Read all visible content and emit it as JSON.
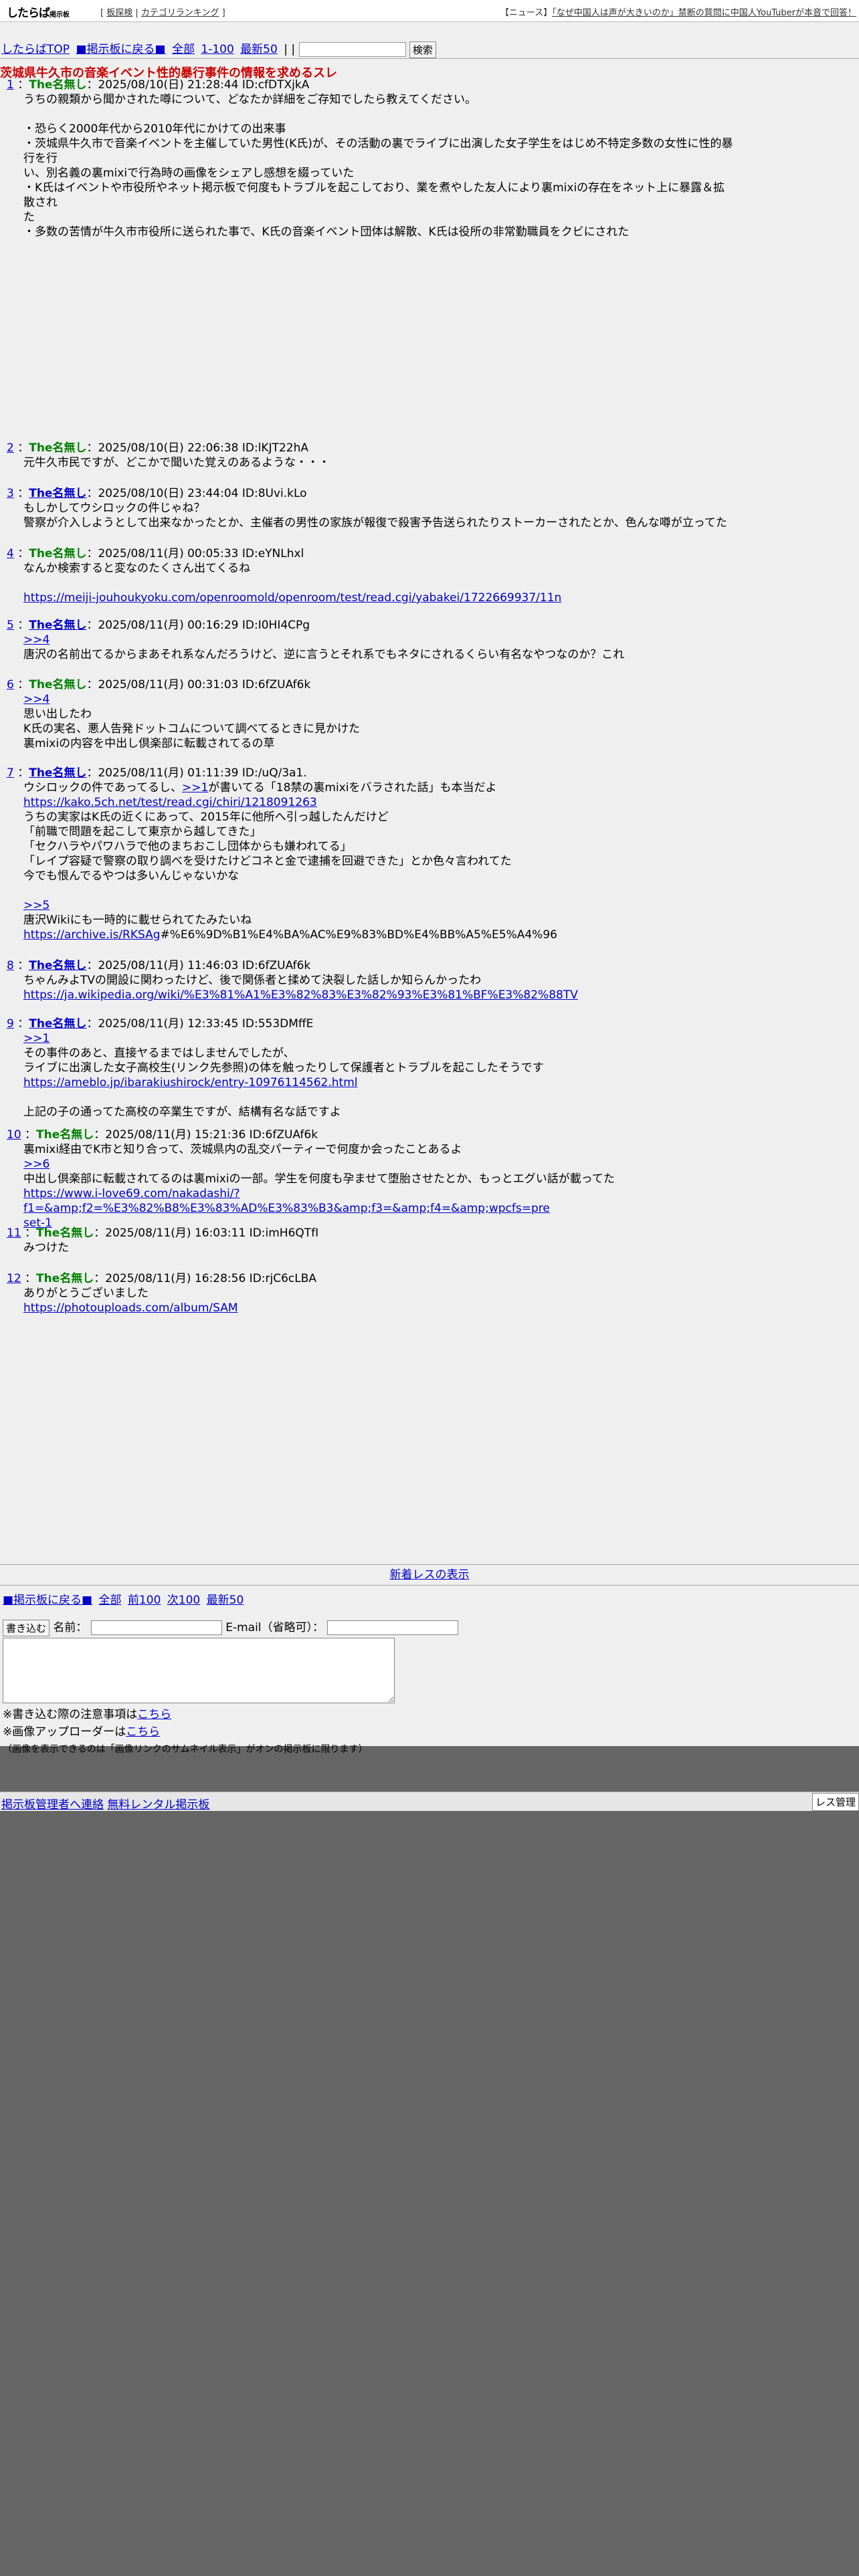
{
  "header": {
    "logo_main": "したらば",
    "logo_sub": "掲示板",
    "bracket_open": "[",
    "bracket_close": "]",
    "sep": "|",
    "link_portal": "板探検",
    "link_ranking": "カテゴリランキング",
    "news_label": "【ニュース】",
    "news_text": "「なぜ中国人は声が大きいのか」禁断の質問に中国人YouTuberが本音で回答！"
  },
  "nav": {
    "top": "したらばTOP",
    "back": "■掲示板に戻る■",
    "all": "全部",
    "range": "1-100",
    "latest": "最新50",
    "pipes": "| |",
    "search_button": "検索"
  },
  "thread": {
    "title": "茨城県牛久市の音楽イベント性的暴行事件の情報を求めるスレ"
  },
  "posts": [
    {
      "num": "1",
      "name": "The名無し",
      "date": "：2025/08/10(日) 21:28:44 ID:cfDTXjkA",
      "lines": [
        "うちの親類から聞かされた噂について、どなたか詳細をご存知でしたら教えてください。",
        "",
        "・恐らく2000年代から2010年代にかけての出来事",
        "・茨城県牛久市で音楽イベントを主催していた男性(K氏)が、その活動の裏でライブに出演した女子学生をはじめ不特定多数の女性に性的暴行を行",
        "い、別名義の裏mixiで行為時の画像をシェアし感想を綴っていた",
        "・K氏はイベントや市役所やネット掲示板で何度もトラブルを起こしており、業を煮やした友人により裏mixiの存在をネット上に暴露＆拡散され",
        "た",
        "・多数の苦情が牛久市市役所に送られた事で、K氏の音楽イベント団体は解散、K氏は役所の非常勤職員をクビにされた"
      ]
    },
    {
      "num": "2",
      "name": "The名無し",
      "date": "：2025/08/10(日) 22:06:38 ID:lKJT22hA",
      "lines": [
        "元牛久市民ですが、どこかで聞いた覚えのあるような・・・"
      ]
    },
    {
      "num": "3",
      "name": "The名無し",
      "date": "：2025/08/10(日) 23:44:04 ID:8Uvi.kLo",
      "lines": [
        "もしかしてウシロックの件じゃね？",
        "警察が介入しようとして出来なかったとか、主催者の男性の家族が報復で殺害予告送られたりストーカーされたとか、色んな噂が立ってた"
      ]
    },
    {
      "num": "4",
      "name": "The名無し",
      "date": "：2025/08/11(月) 00:05:33 ID:eYNLhxl",
      "lines": [
        "なんか検索すると変なのたくさん出てくるね",
        ""
      ],
      "link": "https://meiji-jouhoukyoku.com/openroomold/openroom/test/read.cgi/yabakei/1722669937/11n"
    },
    {
      "num": "5",
      "name": "The名無し",
      "date": "：2025/08/11(月) 00:16:29 ID:I0HI4CPg",
      "anchor": ">>4",
      "lines": [
        "唐沢の名前出てるからまあそれ系なんだろうけど、逆に言うとそれ系でもネタにされるくらい有名なやつなのか？これ"
      ]
    },
    {
      "num": "6",
      "name": "The名無し",
      "date": "：2025/08/11(月) 00:31:03 ID:6fZUAf6k",
      "anchor": ">>4",
      "lines": [
        "思い出したわ",
        "K氏の実名、悪人告発ドットコムについて調べてるときに見かけた",
        "裏mixiの内容を中出し倶楽部に転載されてるの草"
      ]
    },
    {
      "num": "7",
      "name": "The名無し",
      "date": "：2025/08/11(月) 01:11:39 ID:/uQ/3a1.",
      "line1_pre": "ウシロックの件であってるし、",
      "line1_anchor": ">>1",
      "line1_post": "が書いてる「18禁の裏mixiをバラされた話」も本当だよ",
      "link1": "https://kako.5ch.net/test/read.cgi/chiri/1218091263",
      "lines": [
        "うちの実家はK氏の近くにあって、2015年に他所へ引っ越したんだけど",
        "「前職で問題を起こして東京から越してきた」",
        "「セクハラやパワハラで他のまちおこし団体からも嫌われてる」",
        "「レイプ容疑で警察の取り調べを受けたけどコネと金で逮捕を回避できた」とか色々言われてた",
        "今でも恨んでるやつは多いんじゃないかな",
        ""
      ],
      "anchor2": ">>5",
      "line2": "唐沢Wikiにも一時的に載せられてたみたいね",
      "link2_pre": "https://archive.is/RKSAg",
      "link2_post": "#%E6%9D%B1%E4%BA%AC%E9%83%BD%E4%BB%A5%E5%A4%96"
    },
    {
      "num": "8",
      "name": "The名無し",
      "date": "：2025/08/11(月) 11:46:03 ID:6fZUAf6k",
      "lines": [
        "ちゃんみよTVの開設に関わったけど、後で関係者と揉めて決裂した話しか知らんかったわ"
      ],
      "link": "https://ja.wikipedia.org/wiki/%E3%81%A1%E3%82%83%E3%82%93%E3%81%BF%E3%82%88TV"
    },
    {
      "num": "9",
      "name": "The名無し",
      "date": "：2025/08/11(月) 12:33:45 ID:553DMffE",
      "anchor": ">>1",
      "lines": [
        "その事件のあと、直接ヤるまではしませんでしたが、",
        "ライブに出演した女子高校生(リンク先参照)の体を触ったりして保護者とトラブルを起こしたそうです"
      ],
      "link": "https://ameblo.jp/ibarakiushirock/entry-10976114562.html",
      "lines2": [
        "",
        "上記の子の通ってた高校の卒業生ですが、結構有名な話ですよ"
      ]
    },
    {
      "num": "10",
      "name": "The名無し",
      "date": "：2025/08/11(月) 15:21:36 ID:6fZUAf6k",
      "lines": [
        "裏mixi経由でK市と知り合って、茨城県内の乱交パーティーで何度か会ったことあるよ"
      ],
      "anchor": ">>6",
      "lines2": [
        "中出し倶楽部に転載されてるのは裏mixiの一部。学生を何度も孕ませて堕胎させたとか、もっとエグい話が載ってた"
      ],
      "link_l1": "https://www.i-love69.com/nakadashi/?f1=&amp;f2=%E3%82%B8%E3%83%AD%E3%83%B3&amp;f3=&amp;f4=&amp;wpcfs=pre",
      "link_l2": "set-1"
    },
    {
      "num": "11",
      "name": "The名無し",
      "date": "：2025/08/11(月) 16:03:11 ID:imH6QTfI",
      "lines": [
        "みつけた"
      ]
    },
    {
      "num": "12",
      "name": "The名無し",
      "date": "：2025/08/11(月) 16:28:56 ID:rjC6cLBA",
      "lines": [
        "ありがとうございました"
      ],
      "link": "https://photouploads.com/album/SAM"
    }
  ],
  "footer_nav": {
    "new_res": "新着レスの表示",
    "back": "■掲示板に戻る■",
    "all": "全部",
    "prev": "前100",
    "next": "次100",
    "latest": "最新50"
  },
  "form": {
    "submit": "書き込む",
    "name_label": "名前：",
    "email_label": "E-mail（省略可）："
  },
  "notes": {
    "n1_pre": "※書き込む際の注意事項は",
    "n1_link": "こちら",
    "n2_pre": "※画像アップローダーは",
    "n2_link": "こちら",
    "n3": "（画像を表示できるのは「画像リンクのサムネイル表示」がオンの掲示板に限ります）"
  },
  "footer": {
    "admin_contact": "掲示板管理者へ連絡",
    "free_bbs": "無料レンタル掲示板",
    "res_admin": "レス管理"
  }
}
